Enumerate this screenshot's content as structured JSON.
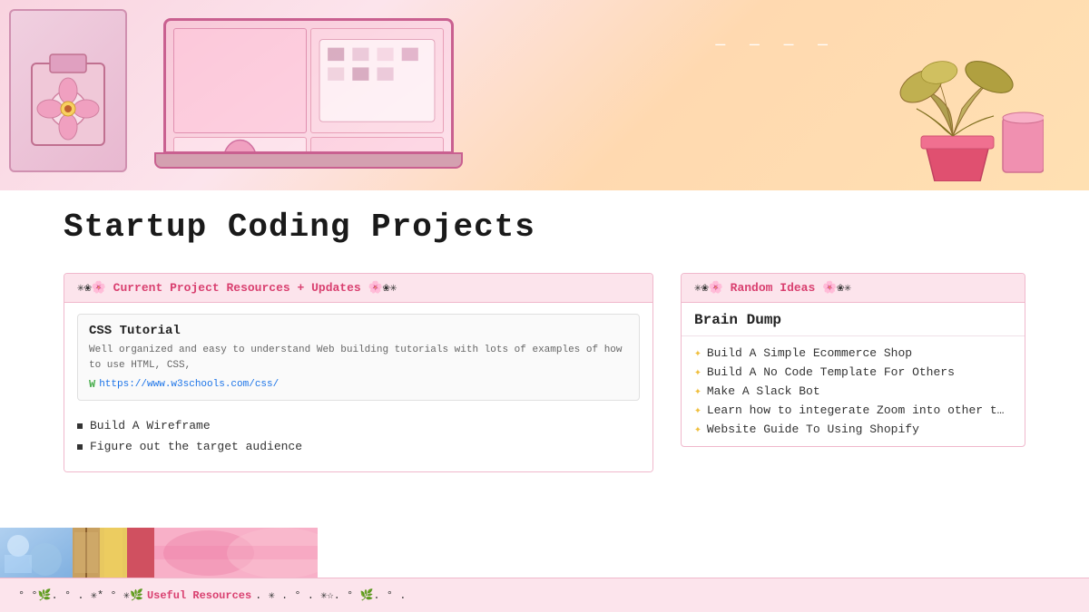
{
  "page": {
    "title": "Startup Coding Projects"
  },
  "banner": {
    "alt": "Pink aesthetic coding workspace illustration"
  },
  "left_section": {
    "header": {
      "prefix_deco": "✳❀🌸 ",
      "title": "Current Project Resources + Updates",
      "suffix_deco": " 🌸❀✳"
    },
    "link_card": {
      "title": "CSS Tutorial",
      "description": "Well organized and easy to understand Web building tutorials with lots of examples of how to use HTML, CSS,",
      "url": "https://www.w3schools.com/css/",
      "url_icon": "W"
    },
    "bullet_items": [
      "Build A Wireframe",
      "Figure out the target audience"
    ]
  },
  "right_section": {
    "header": {
      "prefix_deco": "✳❀🌸 ",
      "title": "Random Ideas",
      "suffix_deco": " 🌸❀✳"
    },
    "brain_dump_label": "Brain Dump",
    "ideas": [
      "Build A Simple Ecommerce Shop",
      "Build A No Code Template For Others",
      "Make A Slack Bot",
      "Learn how to integerate Zoom into other t…",
      "Website Guide To Using Shopify"
    ]
  },
  "bottom_bar": {
    "text_before": "° °🌿. ° . ✳* ° ✳🌿 ",
    "highlight": "Useful Resources",
    "text_after": " . ✳ . ° . ✳☆. ° 🌿. ° ."
  },
  "icons": {
    "sparkle": "✦",
    "bullet": "▪",
    "w3_icon": "W"
  }
}
